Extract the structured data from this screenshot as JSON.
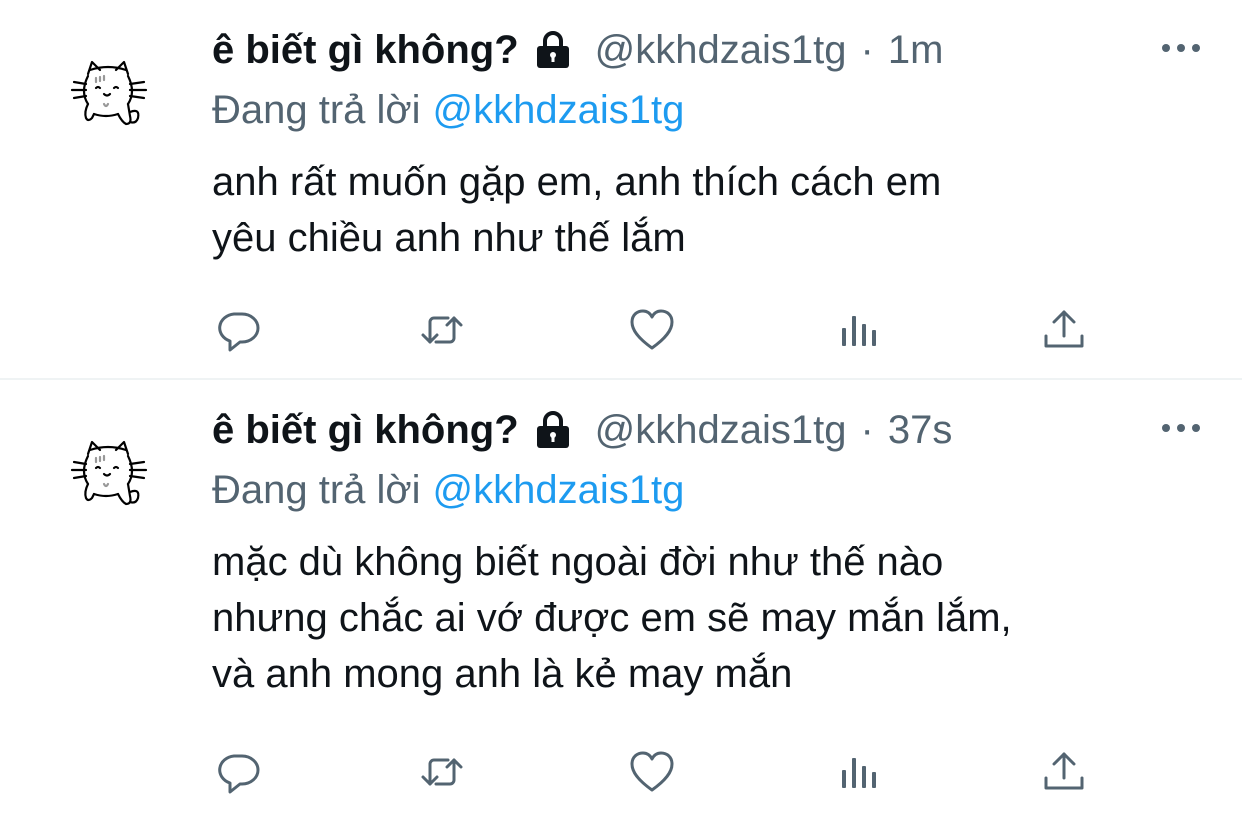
{
  "tweets": [
    {
      "display_name": "ê biết gì không?",
      "handle": "@kkhdzais1tg",
      "separator": "·",
      "time": "1m",
      "replying_label": "Đang trả lời",
      "replying_to": "@kkhdzais1tg",
      "body_lines": [
        "anh rất muốn gặp em, anh thích cách em",
        "yêu chiều anh như thế lắm"
      ],
      "icons": {
        "avatar": "cat-avatar",
        "protected": "lock-icon",
        "more": "more-icon",
        "reply": "reply-icon",
        "retweet": "retweet-icon",
        "like": "like-icon",
        "views": "views-icon",
        "share": "share-icon"
      }
    },
    {
      "display_name": "ê biết gì không?",
      "handle": "@kkhdzais1tg",
      "separator": "·",
      "time": "37s",
      "replying_label": "Đang trả lời",
      "replying_to": "@kkhdzais1tg",
      "body_lines": [
        "mặc dù không biết ngoài đời như thế nào",
        "nhưng chắc ai vớ được em sẽ may mắn lắm,",
        "và anh mong anh là kẻ may mắn"
      ],
      "icons": {
        "avatar": "cat-avatar",
        "protected": "lock-icon",
        "more": "more-icon",
        "reply": "reply-icon",
        "retweet": "retweet-icon",
        "like": "like-icon",
        "views": "views-icon",
        "share": "share-icon"
      }
    }
  ],
  "colors": {
    "text": "#0f1419",
    "secondary": "#536471",
    "link": "#1d9bf0",
    "divider": "#eff3f4"
  }
}
